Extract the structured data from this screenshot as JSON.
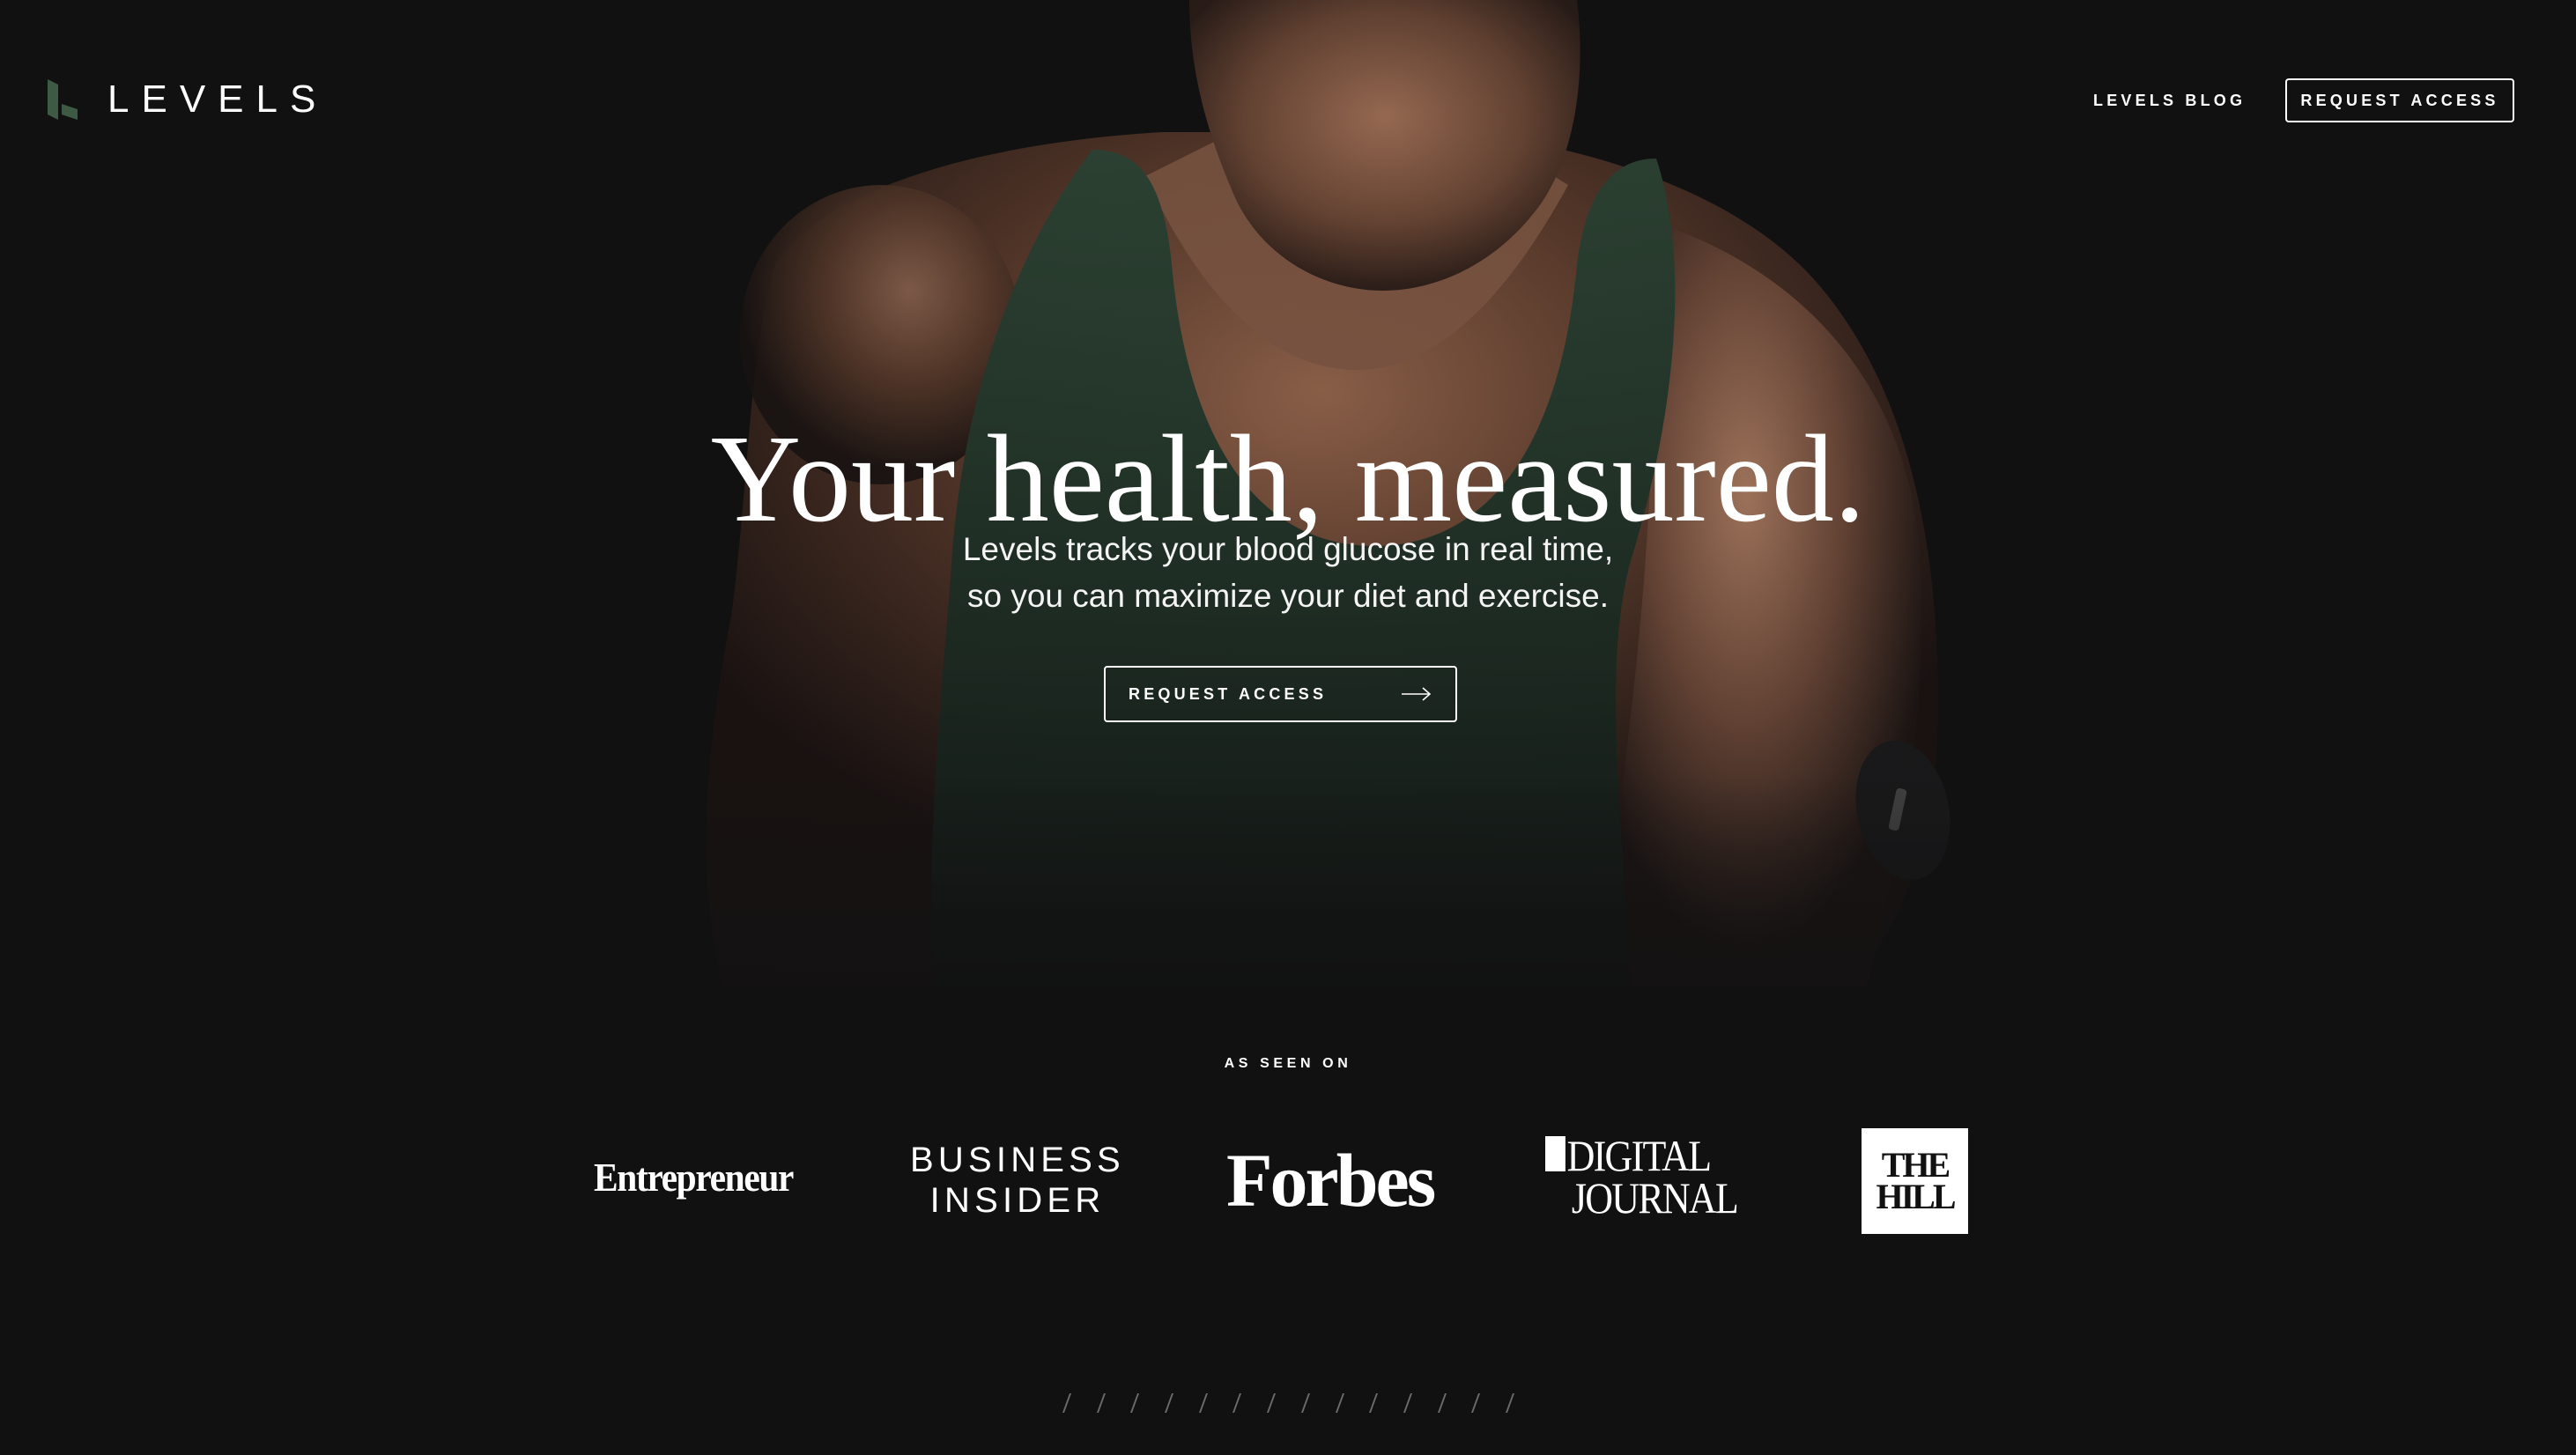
{
  "header": {
    "logo_text": "LEVELS",
    "nav_blog_label": "LEVELS BLOG",
    "nav_request_label": "REQUEST ACCESS"
  },
  "hero": {
    "title": "Your health, measured.",
    "subtitle_line1": "Levels tracks your blood glucose in real time,",
    "subtitle_line2": "so you can maximize your diet and exercise.",
    "cta_label": "REQUEST ACCESS",
    "cta_icon": "arrow-right-icon"
  },
  "press": {
    "label": "AS SEEN ON",
    "logos": {
      "entrepreneur": "Entrepreneur",
      "business_insider_line1": "BUSINESS",
      "business_insider_line2": "INSIDER",
      "forbes": "Forbes",
      "digital_journal_line1": "DIGITAL",
      "digital_journal_line2": "JOURNAL",
      "the_hill_line1": "THE",
      "the_hill_line2": "HILL"
    }
  },
  "colors": {
    "background": "#111112",
    "logo_accent": "#3e5a45",
    "tank_top": "#26382c",
    "text": "#ffffff"
  }
}
